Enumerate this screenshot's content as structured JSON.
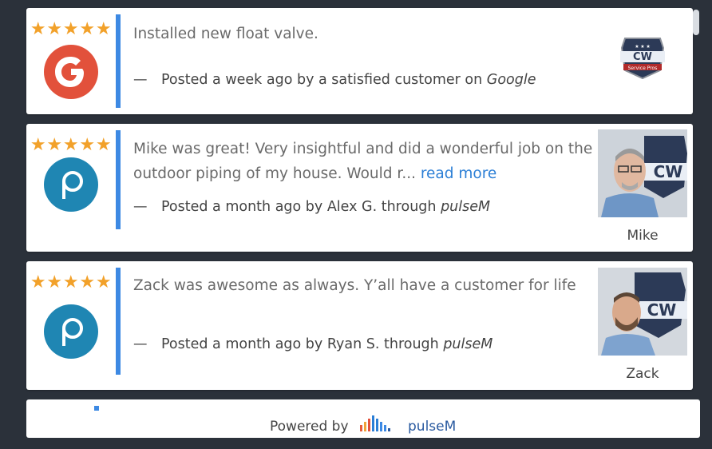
{
  "reviews": [
    {
      "rating": 5,
      "source_icon": "google-g-icon",
      "text": "Installed new float valve.",
      "dash": "—",
      "meta_prefix": "Posted a week ago by a satisfied customer on ",
      "source": "Google",
      "company_logo_text": "CW",
      "company_logo_sub": "Service Pros"
    },
    {
      "rating": 5,
      "source_icon": "pulsem-p-icon",
      "text": "Mike was great! Very insightful and did a wonderful job on the outdoor piping of my house. Would r... ",
      "read_more": "read more",
      "dash": "—",
      "meta_prefix": "Posted a month ago by Alex G. through ",
      "source": "pulseM",
      "technician": "Mike"
    },
    {
      "rating": 5,
      "source_icon": "pulsem-p-icon",
      "text": "Zack was awesome as always. Y’all have a customer for life",
      "dash": "—",
      "meta_prefix": "Posted a month ago by Ryan S. through ",
      "source": "pulseM",
      "technician": "Zack"
    }
  ],
  "footer": {
    "powered_by": "Powered by",
    "brand": "pulseM"
  },
  "colors": {
    "star": "#f2a12a",
    "accent_bar": "#3d89e3",
    "link": "#2c7fd6",
    "google_red": "#e2513b",
    "pulsem_blue": "#1f86b3"
  }
}
